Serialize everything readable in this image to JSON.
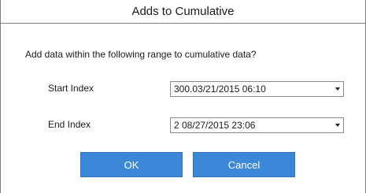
{
  "dialog": {
    "title": "Adds to Cumulative",
    "prompt": "Add data within the following range to cumulative data?"
  },
  "fields": {
    "start": {
      "label": "Start Index",
      "value": "300.03/21/2015 06:10"
    },
    "end": {
      "label": "End Index",
      "value": "2 08/27/2015 23:06"
    }
  },
  "buttons": {
    "ok": "OK",
    "cancel": "Cancel"
  },
  "colors": {
    "accent": "#3d87d8"
  },
  "icons": {
    "dropdown": "chevron-down-icon"
  }
}
